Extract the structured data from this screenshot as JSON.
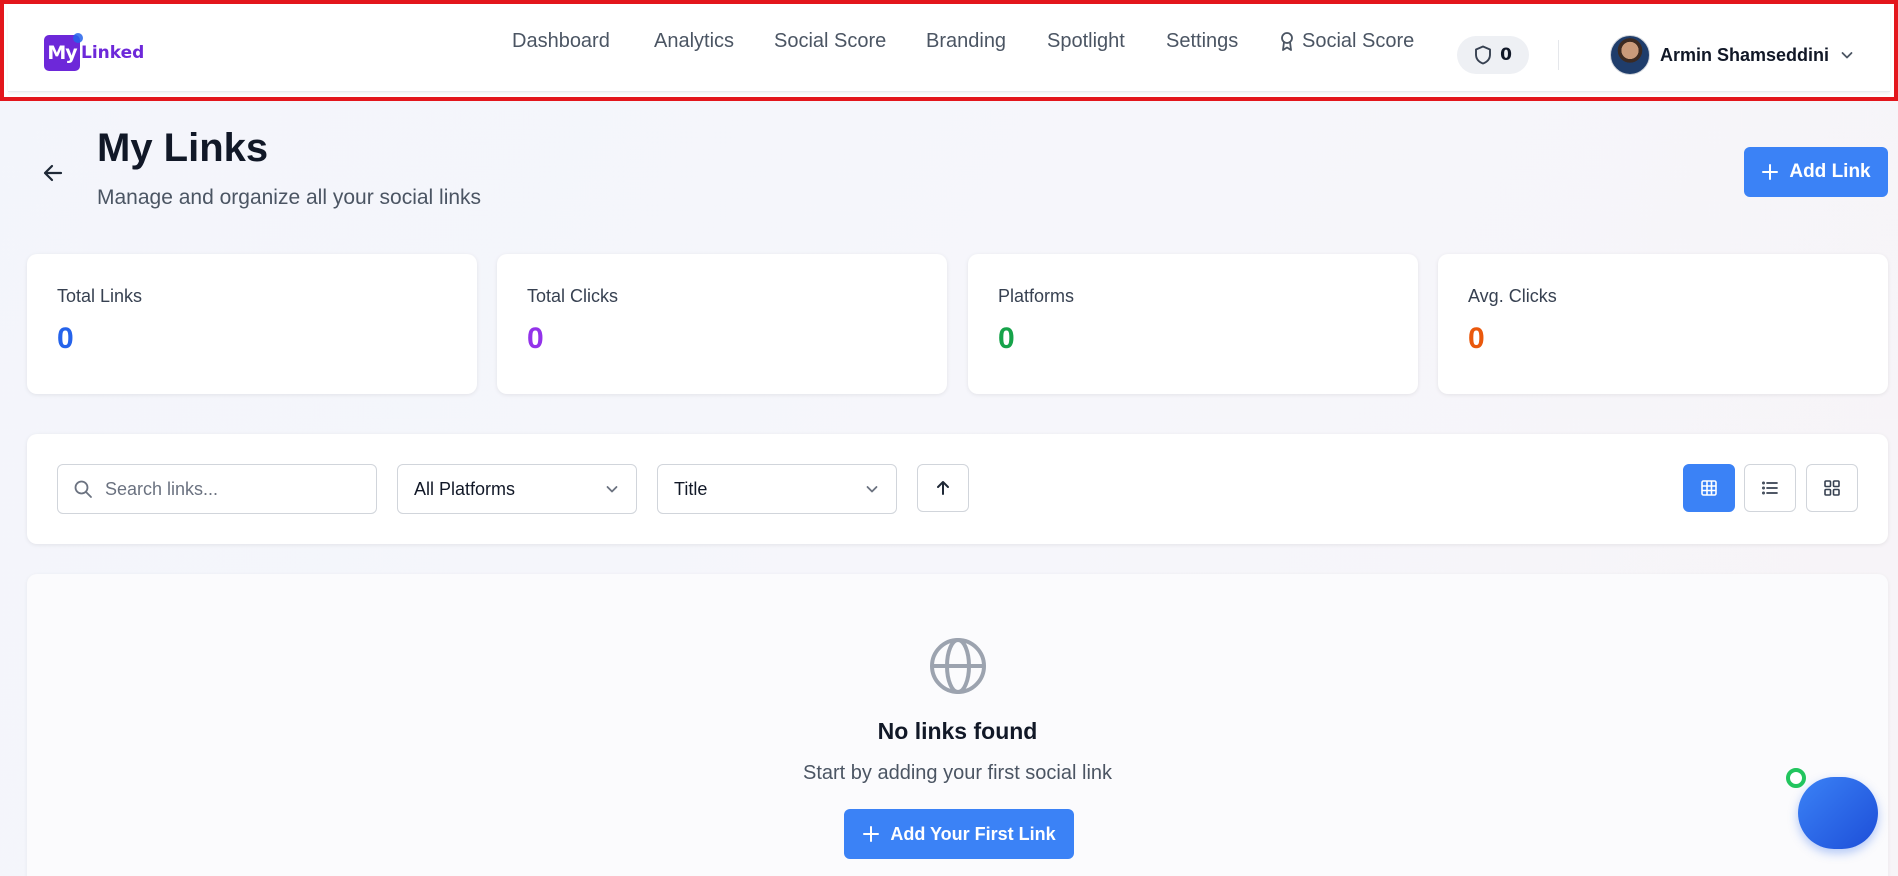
{
  "brand": {
    "logo_short": "My",
    "logo_text": "Linked"
  },
  "nav": {
    "items": [
      "Dashboard",
      "Analytics",
      "Social Score",
      "Branding",
      "Spotlight",
      "Settings"
    ],
    "award_label": "Social Score",
    "shield_count": "0"
  },
  "user": {
    "name": "Armin Shamseddini"
  },
  "page": {
    "title": "My Links",
    "subtitle": "Manage and organize all your social links",
    "add_link_label": "Add Link"
  },
  "stats": [
    {
      "label": "Total Links",
      "value": "0",
      "color": "#2563eb"
    },
    {
      "label": "Total Clicks",
      "value": "0",
      "color": "#9333ea"
    },
    {
      "label": "Platforms",
      "value": "0",
      "color": "#16a34a"
    },
    {
      "label": "Avg. Clicks",
      "value": "0",
      "color": "#ea580c"
    }
  ],
  "filters": {
    "search_placeholder": "Search links...",
    "platform_selected": "All Platforms",
    "sort_selected": "Title"
  },
  "empty_state": {
    "title": "No links found",
    "subtitle": "Start by adding your first social link",
    "button_label": "Add Your First Link"
  },
  "colors": {
    "accent": "#3b82f6",
    "highlight_border": "#e3161c"
  }
}
